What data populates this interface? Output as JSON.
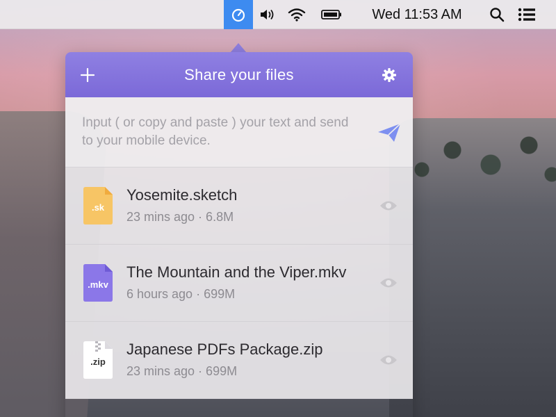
{
  "menubar": {
    "clock": "Wed 11:53 AM",
    "accent": "#3d8bf0",
    "icons": [
      "app-timer-icon",
      "volume-icon",
      "wifi-icon",
      "battery-icon",
      "search-icon",
      "list-menu-icon"
    ]
  },
  "panel": {
    "title": "Share your files",
    "accent": "#7b69d8",
    "compose_placeholder": "Input ( or copy and paste ) your text and send to your mobile device."
  },
  "files": [
    {
      "ext": ".sk",
      "name": "Yosemite.sketch",
      "time": "23 mins ago",
      "size": "6.8M",
      "meta": "23 mins ago · 6.8M",
      "color": "#f7c565"
    },
    {
      "ext": ".mkv",
      "name": "The Mountain and the Viper.mkv",
      "time": "6 hours ago",
      "size": "699M",
      "meta": "6 hours ago · 699M",
      "color": "#8b77e8"
    },
    {
      "ext": ".zip",
      "name": "Japanese PDFs Package.zip",
      "time": "23 mins ago",
      "size": "699M",
      "meta": "23 mins ago · 699M",
      "color": "#ffffff"
    }
  ]
}
